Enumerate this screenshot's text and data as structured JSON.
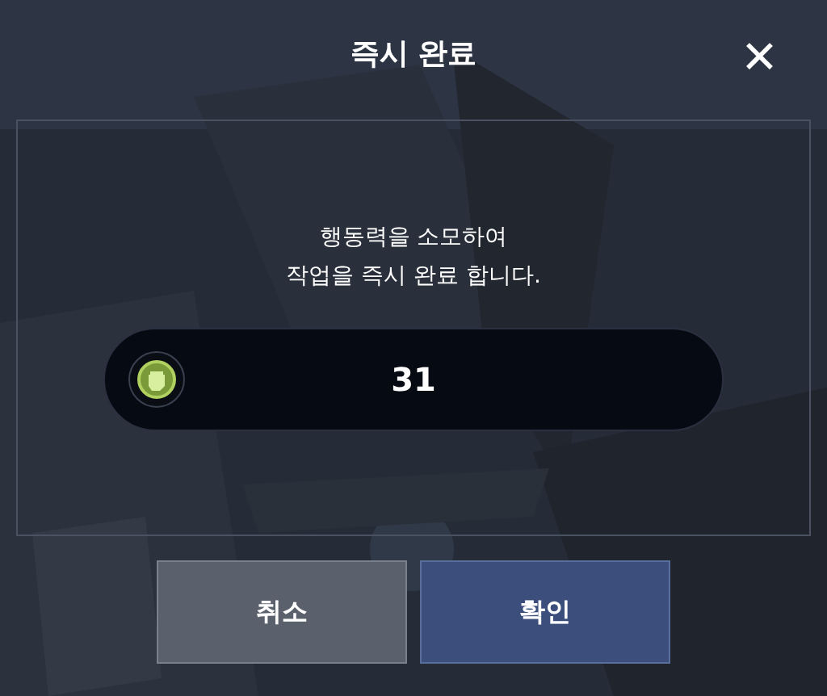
{
  "dialog": {
    "title": "즉시 완료",
    "close": "✕"
  },
  "message": "행동력을 소모하여\n작업을 즉시 완료 합니다.",
  "cost": {
    "amount": "31"
  },
  "buttons": [
    {
      "label": "취소",
      "kind": "cancel"
    },
    {
      "label": "확인",
      "kind": "confirm"
    }
  ]
}
